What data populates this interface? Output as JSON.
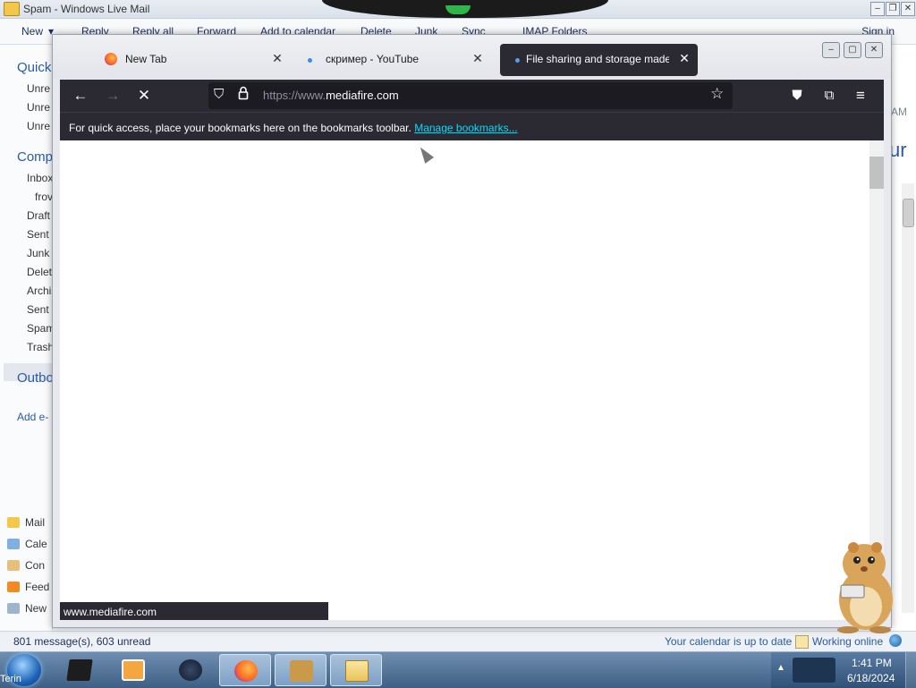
{
  "mail": {
    "title": "Spam - Windows Live Mail",
    "toolbar": {
      "new": "New",
      "reply": "Reply",
      "reply_all": "Reply all",
      "forward": "Forward",
      "add_to_calendar": "Add to calendar",
      "delete": "Delete",
      "junk": "Junk",
      "sync": "Sync",
      "imap_folders": "IMAP Folders",
      "sign_in": "Sign in"
    },
    "sidebar": {
      "quick_views": "Quick",
      "quick_items": [
        "Unre",
        "Unre",
        "Unre"
      ],
      "computer": "Comp",
      "folders": [
        "Inbox",
        "frov",
        "Draft",
        "Sent",
        "Junk",
        "Delet",
        "Archi",
        "Sent",
        "Spam",
        "Trash"
      ],
      "outbox": "Outbo",
      "add_email": "Add e-",
      "nav": [
        "Mail",
        "Cale",
        "Con",
        "Feed",
        "New"
      ]
    },
    "right_pane": {
      "time_fragment": "AM",
      "heading_fragment": "ur"
    },
    "status": {
      "message_count": "801 message(s), 603 unread",
      "calendar": "Your calendar is up to date",
      "online": "Working online"
    }
  },
  "browser": {
    "tabs": [
      {
        "label": "New Tab",
        "active": false
      },
      {
        "label": "скример - YouTube",
        "active": false
      },
      {
        "label": "File sharing and storage made s",
        "active": true
      }
    ],
    "url": {
      "scheme": "https://www.",
      "host": "mediafire.com"
    },
    "bookmarks_bar": {
      "hint": "For quick access, place your bookmarks here on the bookmarks toolbar.",
      "manage_link": "Manage bookmarks..."
    },
    "status_link": "www.mediafire.com",
    "loading": true
  },
  "taskbar": {
    "start_label": "Terin",
    "clock": {
      "time": "1:41 PM",
      "date": "6/18/2024"
    }
  },
  "colors": {
    "firefox_dark": "#2b2a33",
    "url_field": "#1c1b22",
    "link_cyan": "#00ddff",
    "mail_blue": "#2a5aa6"
  }
}
